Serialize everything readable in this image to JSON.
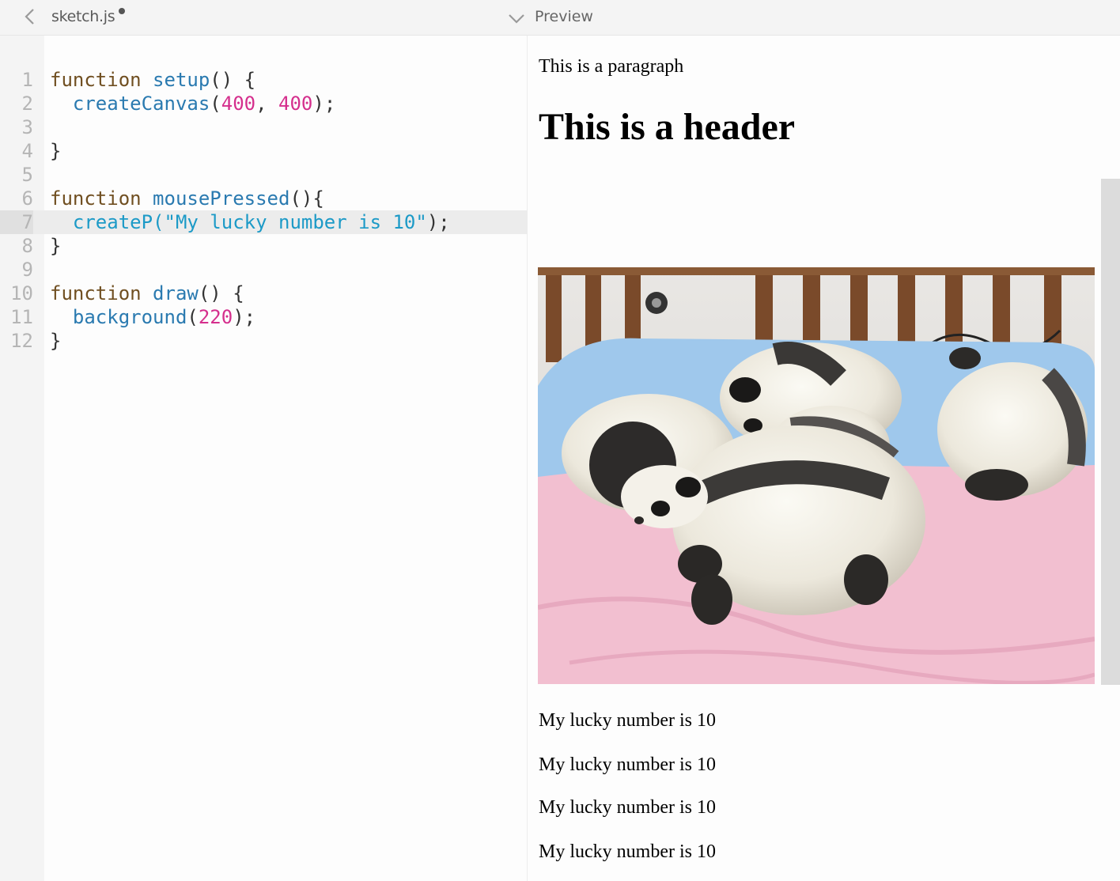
{
  "editor": {
    "file_name": "sketch.js",
    "preview_label": "Preview",
    "active_line": 7,
    "lines": [
      {
        "n": "1",
        "tokens": [
          [
            "kw",
            "function"
          ],
          [
            "pun",
            " "
          ],
          [
            "fn",
            "setup"
          ],
          [
            "pun",
            "() {"
          ]
        ]
      },
      {
        "n": "2",
        "tokens": [
          [
            "pun",
            "  "
          ],
          [
            "fn",
            "createCanvas"
          ],
          [
            "pun",
            "("
          ],
          [
            "num",
            "400"
          ],
          [
            "pun",
            ", "
          ],
          [
            "num",
            "400"
          ],
          [
            "pun",
            ");"
          ]
        ]
      },
      {
        "n": "3",
        "tokens": []
      },
      {
        "n": "4",
        "tokens": [
          [
            "pun",
            "}"
          ]
        ]
      },
      {
        "n": "5",
        "tokens": []
      },
      {
        "n": "6",
        "tokens": [
          [
            "kw",
            "function"
          ],
          [
            "pun",
            " "
          ],
          [
            "fn",
            "mousePressed"
          ],
          [
            "pun",
            "(){"
          ]
        ]
      },
      {
        "n": "7",
        "tokens": [
          [
            "pun",
            "  "
          ],
          [
            "str",
            "createP(\"My lucky number is 10\""
          ],
          [
            "pun",
            ");"
          ]
        ]
      },
      {
        "n": "8",
        "tokens": [
          [
            "pun",
            "}"
          ]
        ]
      },
      {
        "n": "9",
        "tokens": []
      },
      {
        "n": "10",
        "tokens": [
          [
            "kw",
            "function"
          ],
          [
            "pun",
            " "
          ],
          [
            "fn",
            "draw"
          ],
          [
            "pun",
            "() {"
          ]
        ]
      },
      {
        "n": "11",
        "tokens": [
          [
            "pun",
            "  "
          ],
          [
            "fn",
            "background"
          ],
          [
            "pun",
            "("
          ],
          [
            "num",
            "220"
          ],
          [
            "pun",
            ");"
          ]
        ]
      },
      {
        "n": "12",
        "tokens": [
          [
            "pun",
            "}"
          ]
        ]
      }
    ]
  },
  "preview": {
    "paragraph": "This is a paragraph",
    "header": "This is a header",
    "outputs": [
      "My lucky number is 10",
      "My lucky number is 10",
      "My lucky number is 10",
      "My lucky number is 10"
    ]
  },
  "icons": {
    "back": "chevron-left-icon",
    "toggle": "chevron-down-icon",
    "unsaved": "unsaved-dot-icon"
  },
  "colors": {
    "keyword": "#704f21",
    "function": "#2a7ab0",
    "number": "#d52f8d",
    "string": "#1c9ac7"
  }
}
